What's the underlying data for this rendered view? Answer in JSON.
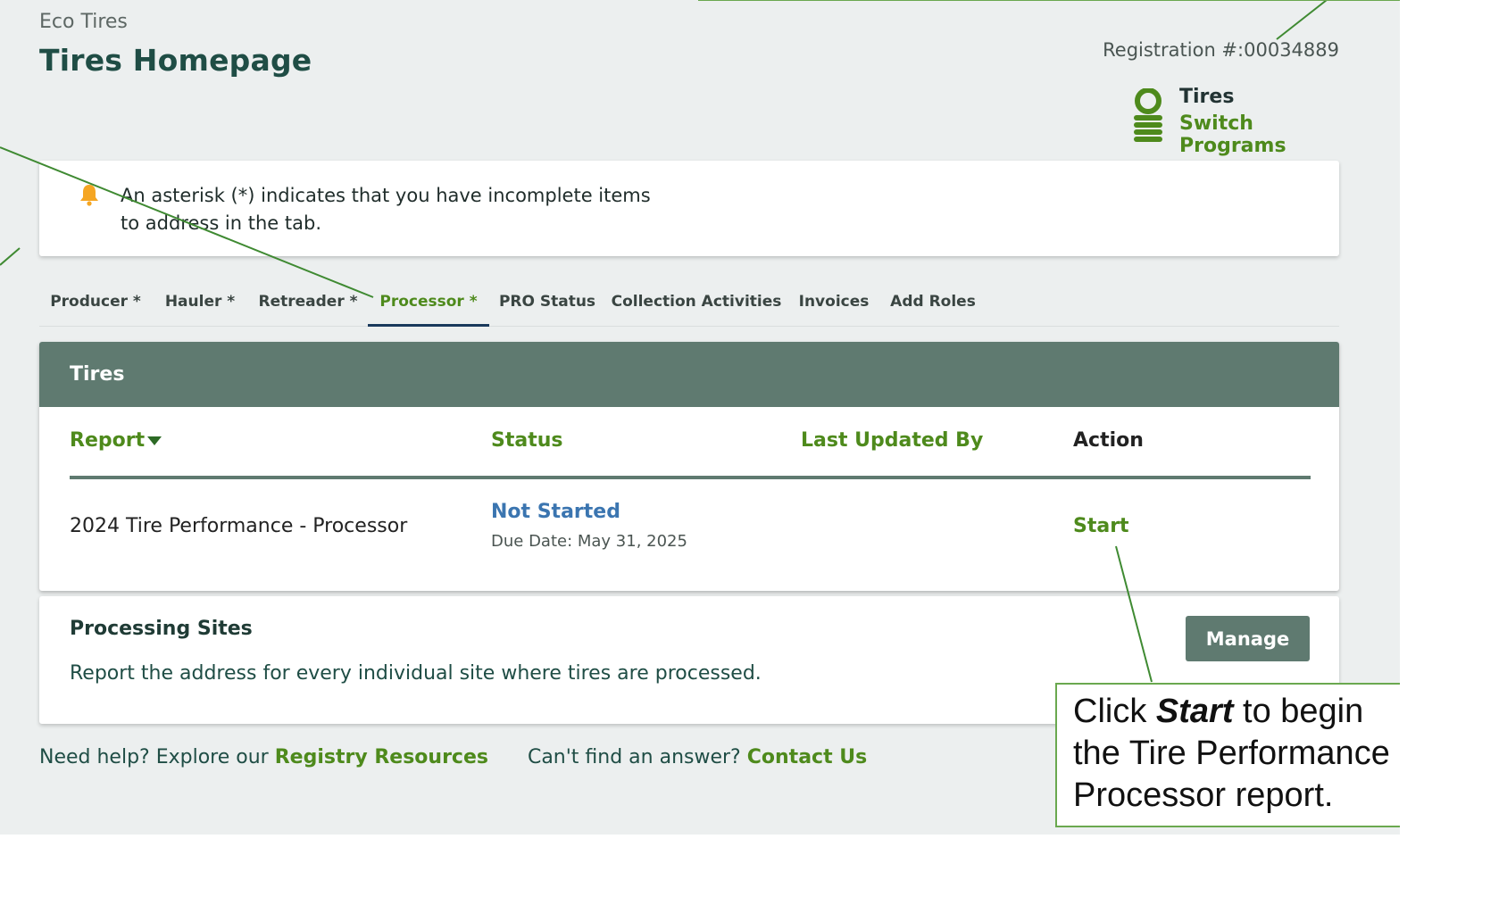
{
  "header": {
    "org": "Eco Tires",
    "title": "Tires Homepage",
    "registration": "Registration #:00034889",
    "program": {
      "name": "Tires",
      "switch_label": "Switch Programs",
      "icon": "tire-stack-icon"
    }
  },
  "notice": {
    "icon": "bell-icon",
    "text": "An asterisk (*) indicates that you have incomplete items to address in the tab."
  },
  "tabs": [
    {
      "label": "Producer *"
    },
    {
      "label": "Hauler *"
    },
    {
      "label": "Retreader *"
    },
    {
      "label": "Processor *",
      "active": true
    },
    {
      "label": "PRO Status"
    },
    {
      "label": "Collection Activities"
    },
    {
      "label": "Invoices"
    },
    {
      "label": "Add Roles"
    }
  ],
  "table": {
    "title": "Tires",
    "columns": {
      "report": "Report",
      "status": "Status",
      "last_updated_by": "Last Updated By",
      "action": "Action"
    },
    "rows": [
      {
        "report": "2024 Tire Performance - Processor",
        "status": "Not Started",
        "due": "Due Date: May 31, 2025",
        "last_updated_by": "",
        "action": "Start"
      }
    ]
  },
  "sites": {
    "title": "Processing Sites",
    "description": "Report the address for every individual site where tires are processed.",
    "button": "Manage"
  },
  "footer": {
    "help_text": "Need help?  Explore our",
    "resources_link": "Registry Resources",
    "answer_text": "Can't find an answer?",
    "contact_link": "Contact Us"
  },
  "callout": {
    "prefix": "Click ",
    "bold": "Start",
    "suffix": " to begin the Tire Performance Processor report."
  },
  "colors": {
    "accent_green": "#4e8a1c",
    "header_band": "#5f7a70",
    "status_blue": "#3b75b0",
    "notice_bell": "#f5a623",
    "callout_border": "#6aa84f"
  }
}
